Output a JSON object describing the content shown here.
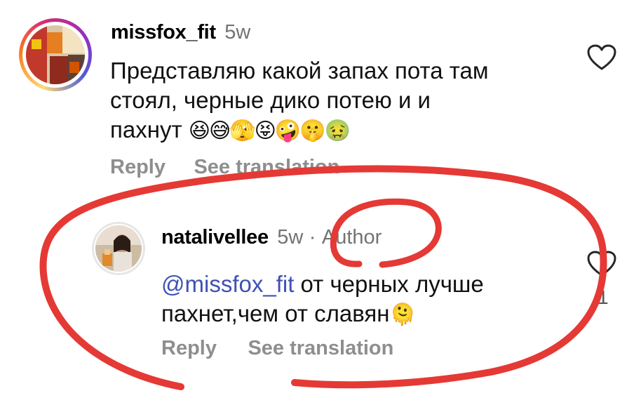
{
  "comments": [
    {
      "username": "missfox_fit",
      "time": "5w",
      "text_lines": [
        "Представляю какой запах пота там",
        "стоял, черные дико потею и и",
        "пахнут"
      ],
      "emojis": "😆😅🫣😝🤪🤫🤢",
      "reply_label": "Reply",
      "translate_label": "See translation"
    },
    {
      "username": "natalivellee",
      "time": "5w",
      "badge_separator": "·",
      "badge": "Author",
      "mention": "@missfox_fit",
      "text_line1_rest": " от черных лучше",
      "text_line2": "пахнет,чем от славян",
      "emoji": "🫠",
      "reply_label": "Reply",
      "translate_label": "See translation",
      "like_count": "1"
    }
  ],
  "icons": [
    "heart-icon",
    "heart-icon"
  ],
  "colors": {
    "annotation_red": "#e53935",
    "mention_blue": "#3f51b5",
    "secondary_gray": "#8e8e8e"
  }
}
